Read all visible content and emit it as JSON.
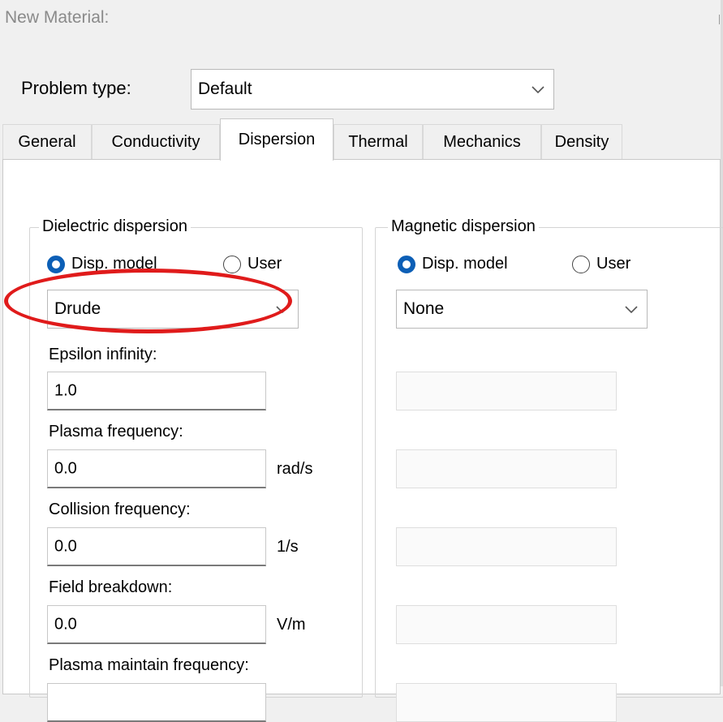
{
  "window": {
    "title": "New Material:"
  },
  "problem_type": {
    "label": "Problem type:",
    "value": "Default"
  },
  "tabs": [
    {
      "label": "General"
    },
    {
      "label": "Conductivity"
    },
    {
      "label": "Dispersion"
    },
    {
      "label": "Thermal"
    },
    {
      "label": "Mechanics"
    },
    {
      "label": "Density"
    }
  ],
  "active_tab": "Dispersion",
  "dielectric": {
    "title": "Dielectric dispersion",
    "radio_model": "Disp. model",
    "radio_user": "User",
    "selected": "Disp. model",
    "model_value": "Drude",
    "fields": [
      {
        "label": "Epsilon infinity:",
        "value": "1.0",
        "unit": ""
      },
      {
        "label": "Plasma frequency:",
        "value": "0.0",
        "unit": "rad/s"
      },
      {
        "label": "Collision frequency:",
        "value": "0.0",
        "unit": "1/s"
      },
      {
        "label": "Field breakdown:",
        "value": "0.0",
        "unit": "V/m"
      },
      {
        "label": "Plasma maintain frequency:",
        "value": "",
        "unit": ""
      }
    ]
  },
  "magnetic": {
    "title": "Magnetic dispersion",
    "radio_model": "Disp. model",
    "radio_user": "User",
    "selected": "Disp. model",
    "model_value": "None"
  },
  "colors": {
    "highlight_ellipse": "#e01b1b",
    "radio_accent": "#0c5fb6"
  }
}
